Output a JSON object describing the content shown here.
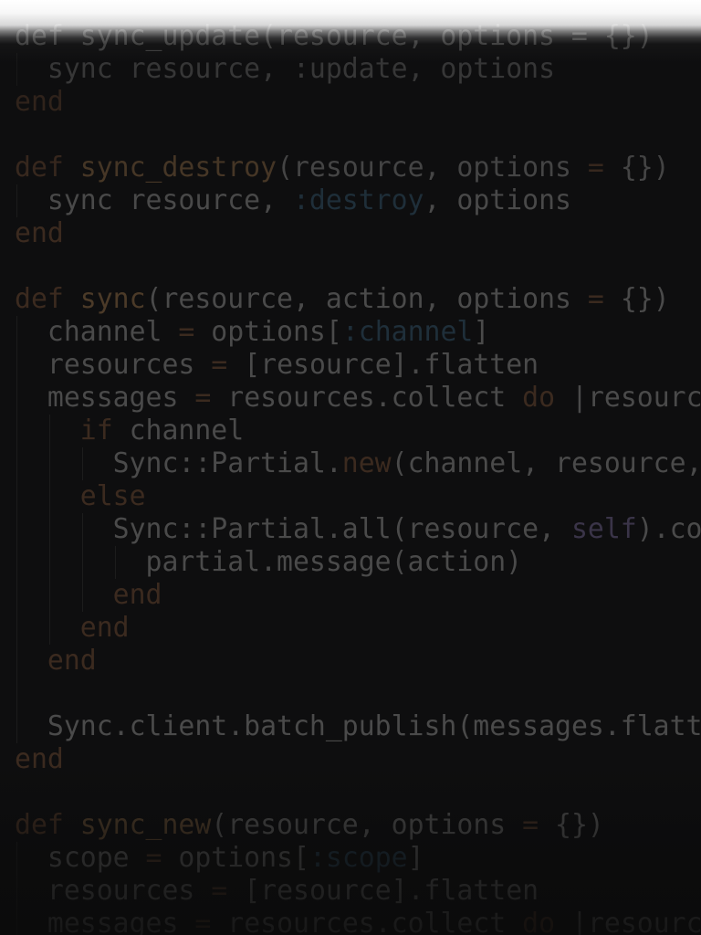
{
  "editor": {
    "language": "ruby",
    "theme_colors": {
      "background": "#0e0e0f",
      "text": "#4a4a4a",
      "keyword": "#3b2a1f",
      "function_name": "#4b3a28",
      "symbol": "#1f2f3a",
      "self": "#3a3448"
    },
    "lines": [
      {
        "indent": 0,
        "tokens": [
          {
            "t": "def sync_update(resource, options = {})",
            "c": "plain"
          }
        ]
      },
      {
        "indent": 1,
        "tokens": [
          {
            "t": "sync resource, :update, options",
            "c": "plain"
          }
        ]
      },
      {
        "indent": 0,
        "tokens": [
          {
            "t": "end",
            "c": "keyword"
          }
        ]
      },
      {
        "indent": 0,
        "tokens": []
      },
      {
        "indent": 0,
        "tokens": [
          {
            "t": "def",
            "c": "keyword"
          },
          {
            "t": " ",
            "c": "plain"
          },
          {
            "t": "sync_destroy",
            "c": "fn"
          },
          {
            "t": "(resource, options ",
            "c": "plain"
          },
          {
            "t": "=",
            "c": "op"
          },
          {
            "t": " {})",
            "c": "plain"
          }
        ]
      },
      {
        "indent": 1,
        "tokens": [
          {
            "t": "sync resource, ",
            "c": "plain"
          },
          {
            "t": ":destroy",
            "c": "symbol"
          },
          {
            "t": ", options",
            "c": "plain"
          }
        ]
      },
      {
        "indent": 0,
        "tokens": [
          {
            "t": "end",
            "c": "keyword"
          }
        ]
      },
      {
        "indent": 0,
        "tokens": []
      },
      {
        "indent": 0,
        "tokens": [
          {
            "t": "def",
            "c": "keyword"
          },
          {
            "t": " ",
            "c": "plain"
          },
          {
            "t": "sync",
            "c": "fn"
          },
          {
            "t": "(resource, action, options ",
            "c": "plain"
          },
          {
            "t": "=",
            "c": "op"
          },
          {
            "t": " {})",
            "c": "plain"
          }
        ]
      },
      {
        "indent": 1,
        "tokens": [
          {
            "t": "channel ",
            "c": "plain"
          },
          {
            "t": "=",
            "c": "op"
          },
          {
            "t": " options[",
            "c": "plain"
          },
          {
            "t": ":channel",
            "c": "symbol"
          },
          {
            "t": "]",
            "c": "plain"
          }
        ]
      },
      {
        "indent": 1,
        "tokens": [
          {
            "t": "resources ",
            "c": "plain"
          },
          {
            "t": "=",
            "c": "op"
          },
          {
            "t": " [resource].flatten",
            "c": "plain"
          }
        ]
      },
      {
        "indent": 1,
        "tokens": [
          {
            "t": "messages ",
            "c": "plain"
          },
          {
            "t": "=",
            "c": "op"
          },
          {
            "t": " resources.collect ",
            "c": "plain"
          },
          {
            "t": "do",
            "c": "keyword"
          },
          {
            "t": " |resource",
            "c": "plain"
          }
        ]
      },
      {
        "indent": 2,
        "tokens": [
          {
            "t": "if",
            "c": "keyword"
          },
          {
            "t": " channel",
            "c": "plain"
          }
        ]
      },
      {
        "indent": 3,
        "tokens": [
          {
            "t": "Sync::Partial.",
            "c": "plain"
          },
          {
            "t": "new",
            "c": "keyword"
          },
          {
            "t": "(channel, resource,",
            "c": "plain"
          }
        ]
      },
      {
        "indent": 2,
        "tokens": [
          {
            "t": "else",
            "c": "keyword"
          }
        ]
      },
      {
        "indent": 3,
        "tokens": [
          {
            "t": "Sync::Partial.all(resource, ",
            "c": "plain"
          },
          {
            "t": "self",
            "c": "self"
          },
          {
            "t": ").co",
            "c": "plain"
          }
        ]
      },
      {
        "indent": 4,
        "tokens": [
          {
            "t": "partial.message(action)",
            "c": "plain"
          }
        ]
      },
      {
        "indent": 3,
        "tokens": [
          {
            "t": "end",
            "c": "keyword"
          }
        ]
      },
      {
        "indent": 2,
        "tokens": [
          {
            "t": "end",
            "c": "keyword"
          }
        ]
      },
      {
        "indent": 1,
        "tokens": [
          {
            "t": "end",
            "c": "keyword"
          }
        ]
      },
      {
        "indent": 0,
        "guides": 1,
        "tokens": []
      },
      {
        "indent": 1,
        "tokens": [
          {
            "t": "Sync.client.batch_publish(messages.flatt",
            "c": "plain"
          }
        ]
      },
      {
        "indent": 0,
        "tokens": [
          {
            "t": "end",
            "c": "keyword"
          }
        ]
      },
      {
        "indent": 0,
        "tokens": []
      },
      {
        "indent": 0,
        "tokens": [
          {
            "t": "def",
            "c": "keyword"
          },
          {
            "t": " ",
            "c": "plain"
          },
          {
            "t": "sync_new",
            "c": "fn"
          },
          {
            "t": "(resource, options ",
            "c": "plain"
          },
          {
            "t": "=",
            "c": "op"
          },
          {
            "t": " {})",
            "c": "plain"
          }
        ]
      },
      {
        "indent": 1,
        "tokens": [
          {
            "t": "scope ",
            "c": "plain"
          },
          {
            "t": "=",
            "c": "op"
          },
          {
            "t": " options[",
            "c": "plain"
          },
          {
            "t": ":scope",
            "c": "symbol"
          },
          {
            "t": "]",
            "c": "plain"
          }
        ]
      },
      {
        "indent": 1,
        "tokens": [
          {
            "t": "resources ",
            "c": "plain"
          },
          {
            "t": "=",
            "c": "op"
          },
          {
            "t": " [resource].flatten",
            "c": "plain"
          }
        ]
      },
      {
        "indent": 1,
        "tokens": [
          {
            "t": "messages ",
            "c": "plain"
          },
          {
            "t": "=",
            "c": "op"
          },
          {
            "t": " resources.collect ",
            "c": "plain"
          },
          {
            "t": "do",
            "c": "keyword"
          },
          {
            "t": " |resourc",
            "c": "plain"
          }
        ]
      }
    ]
  }
}
